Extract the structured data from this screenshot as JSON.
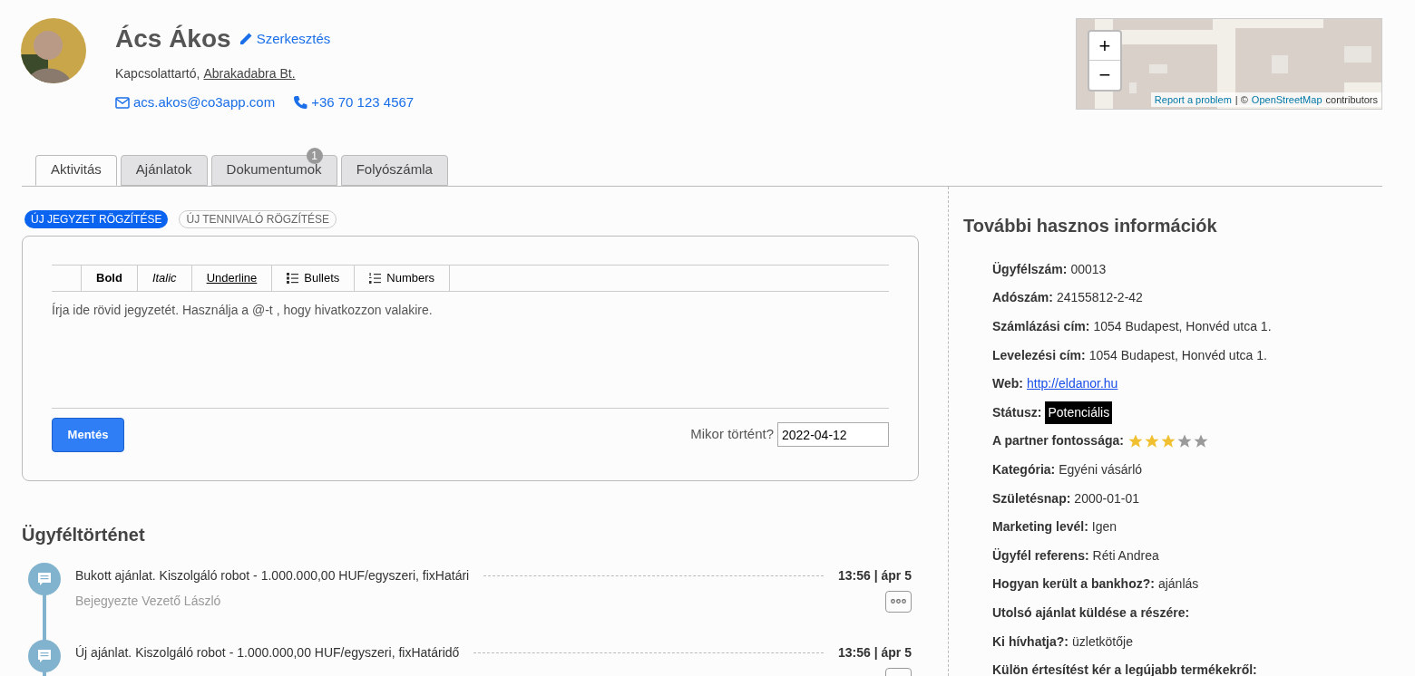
{
  "contact": {
    "name": "Ács Ákos",
    "edit_link": "Szerkesztés",
    "role": "Kapcsolattartó,",
    "company": "Abrakadabra Bt.",
    "email": "acs.akos@co3app.com",
    "phone": "+36 70 123 4567"
  },
  "map": {
    "kind": "picture",
    "zoom_in": "+",
    "zoom_out": "−",
    "report_link": "Report a problem",
    "separator": "| ©",
    "osm_link": "OpenStreetMap",
    "contributors": "contributors"
  },
  "tabs": [
    {
      "label": "Aktivitás",
      "selected": true
    },
    {
      "label": "Ajánlatok",
      "selected": false
    },
    {
      "label": "Dokumentumok",
      "selected": false,
      "badge": "1"
    },
    {
      "label": "Folyószámla",
      "selected": false
    }
  ],
  "note_modes": [
    {
      "label": "ÚJ JEGYZET RÖGZÍTÉSE",
      "selected": true
    },
    {
      "label": "ÚJ TENNIVALÓ RÖGZÍTÉSE",
      "selected": false
    }
  ],
  "editor": {
    "toolbar": [
      {
        "kind": "bold",
        "label": "Bold"
      },
      {
        "kind": "italic",
        "label": "Italic"
      },
      {
        "kind": "underline",
        "label": "Underline"
      },
      {
        "kind": "bullets",
        "label": "Bullets"
      },
      {
        "kind": "numbers",
        "label": "Numbers"
      }
    ],
    "placeholder": "Írja ide rövid jegyzetét. Használja a @-t , hogy hivatkozzon valakire.",
    "save_button": "Mentés",
    "date_label": "Mikor történt?",
    "date_value": "2022-04-12"
  },
  "history": {
    "title": "Ügyféltörténet",
    "items": [
      {
        "text": "Bukott ajánlat. Kiszolgáló robot - 1.000.000,00 HUF/egyszeri, fixHatári",
        "time": "13:56 | ápr 5",
        "author": "Bejegyezte Vezető László"
      },
      {
        "text": "Új ajánlat. Kiszolgáló robot - 1.000.000,00 HUF/egyszeri, fixHatáridő",
        "time": "13:56 | ápr 5"
      }
    ]
  },
  "info": {
    "title": "További hasznos információk",
    "rows": [
      {
        "kind": "text",
        "label": "Ügyfélszám:",
        "value": "00013"
      },
      {
        "kind": "text",
        "label": "Adószám:",
        "value": "24155812-2-42"
      },
      {
        "kind": "text",
        "label": "Számlázási cím:",
        "value": "1054 Budapest, Honvéd utca 1."
      },
      {
        "kind": "text",
        "label": "Levelezési cím:",
        "value": "1054 Budapest, Honvéd utca 1."
      },
      {
        "kind": "link",
        "label": "Web:",
        "value": "http://eldanor.hu"
      },
      {
        "kind": "badge",
        "label": "Státusz:",
        "value": "Potenciális"
      },
      {
        "kind": "stars",
        "label": "A partner fontossága:",
        "stars": 3
      },
      {
        "kind": "text",
        "label": "Kategória:",
        "value": "Egyéni vásárló"
      },
      {
        "kind": "text",
        "label": "Születésnap:",
        "value": "2000-01-01"
      },
      {
        "kind": "text",
        "label": "Marketing levél:",
        "value": "Igen"
      },
      {
        "kind": "text",
        "label": "Ügyfél referens:",
        "value": "Réti Andrea"
      },
      {
        "kind": "text",
        "label": "Hogyan került a bankhoz?:",
        "value": "ajánlás"
      },
      {
        "kind": "text",
        "label": "Utolsó ajánlat küldése a részére:"
      },
      {
        "kind": "text",
        "label": "Ki hívhatja?:",
        "value": "üzletkötője"
      },
      {
        "kind": "text",
        "label": "Külön értesítést kér a legújabb termékekről:"
      }
    ]
  }
}
